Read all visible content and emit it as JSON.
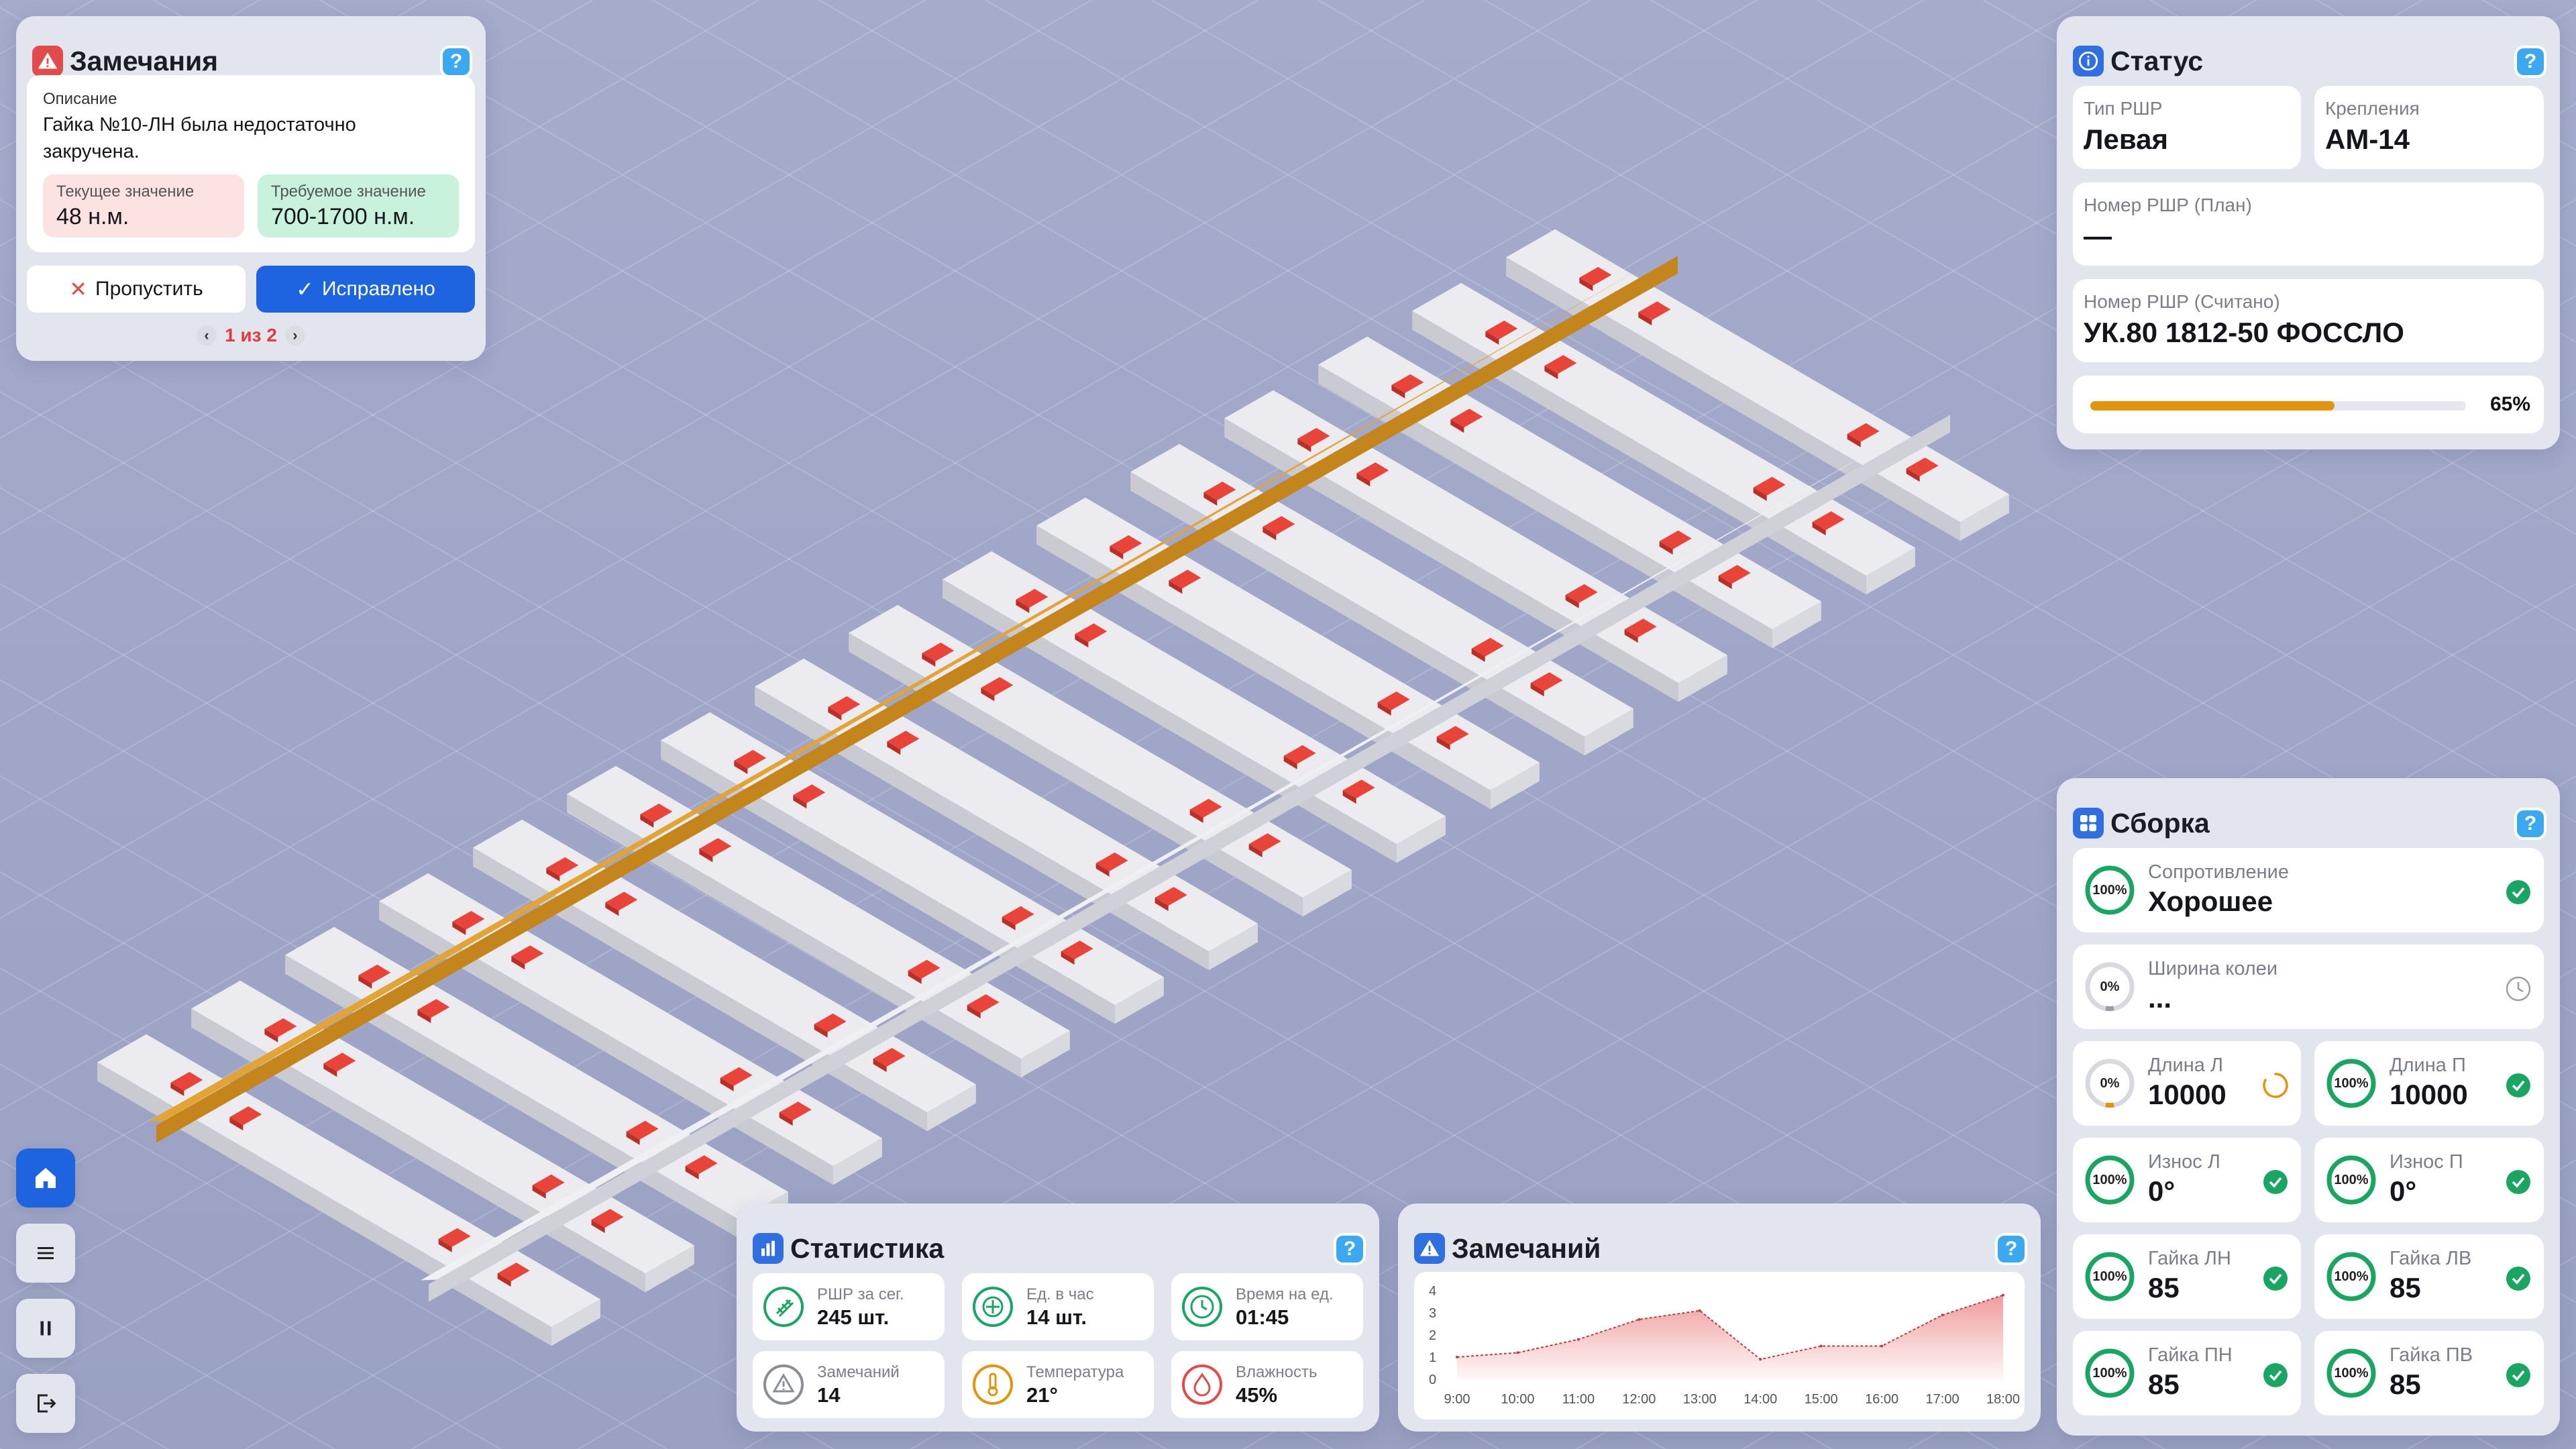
{
  "remarks": {
    "title": "Замечания",
    "desc_label": "Описание",
    "desc_text": "Гайка №10-ЛН была недостаточно закручена.",
    "current_label": "Текущее значение",
    "current_value": "48 н.м.",
    "required_label": "Требуемое значение",
    "required_value": "700-1700 н.м.",
    "skip_label": "Пропустить",
    "fixed_label": "Исправлено",
    "pager": "1 из 2",
    "colors": {
      "icon": "#e24b4b",
      "primary": "#1e63e0",
      "current_bg": "#fde2e2",
      "required_bg": "#c9f2dd"
    }
  },
  "status": {
    "title": "Статус",
    "type_label": "Тип РШР",
    "type_value": "Левая",
    "fasten_label": "Крепления",
    "fasten_value": "АМ-14",
    "plan_label": "Номер РШР (План)",
    "plan_value": "—",
    "read_label": "Номер РШР (Считано)",
    "read_value": "УК.80 1812-50 ФОССЛО",
    "progress": 0.65,
    "progress_text": "65%",
    "colors": {
      "icon": "#2f6fe0",
      "progress": "#e0940f"
    }
  },
  "assembly": {
    "title": "Сборка",
    "colors": {
      "ok": "#1aa563",
      "pending": "#e0940f",
      "idle": "#9a9ca6",
      "icon": "#2f6fe0"
    },
    "resistance": {
      "label": "Сопротивление",
      "value": "Хорошее",
      "pct": "100%",
      "state": "check-icon"
    },
    "gauge": {
      "label": "Ширина колеи",
      "value": "...",
      "pct": "0%",
      "state": "clock-icon"
    },
    "items": [
      {
        "label": "Длина Л",
        "value": "10000",
        "pct": "0%",
        "state": "loading-icon"
      },
      {
        "label": "Длина П",
        "value": "10000",
        "pct": "100%",
        "state": "check-icon"
      },
      {
        "label": "Износ Л",
        "value": "0°",
        "pct": "100%",
        "state": "check-icon"
      },
      {
        "label": "Износ П",
        "value": "0°",
        "pct": "100%",
        "state": "check-icon"
      },
      {
        "label": "Гайка ЛН",
        "value": "85",
        "pct": "100%",
        "state": "check-icon"
      },
      {
        "label": "Гайка ЛВ",
        "value": "85",
        "pct": "100%",
        "state": "check-icon"
      },
      {
        "label": "Гайка ПН",
        "value": "85",
        "pct": "100%",
        "state": "check-icon"
      },
      {
        "label": "Гайка ПВ",
        "value": "85",
        "pct": "100%",
        "state": "check-icon"
      }
    ]
  },
  "stats": {
    "title": "Статистика",
    "items": [
      {
        "label": "РШР за сег.",
        "value": "245 шт.",
        "icon": "rail-icon",
        "color": "#1aa563"
      },
      {
        "label": "Ед. в час",
        "value": "14 шт.",
        "icon": "crosshair-icon",
        "color": "#1aa563"
      },
      {
        "label": "Время на ед.",
        "value": "01:45",
        "icon": "clock-icon",
        "color": "#1aa563"
      },
      {
        "label": "Замечаний",
        "value": "14",
        "icon": "warning-icon",
        "color": "#8a8c96"
      },
      {
        "label": "Температура",
        "value": "21°",
        "icon": "thermometer-icon",
        "color": "#e0940f"
      },
      {
        "label": "Влажность",
        "value": "45%",
        "icon": "drop-icon",
        "color": "#e24b4b"
      }
    ]
  },
  "remarks_chart": {
    "title": "Замечаний"
  },
  "chart_data": {
    "type": "area",
    "x": [
      "9:00",
      "10:00",
      "11:00",
      "12:00",
      "13:00",
      "14:00",
      "15:00",
      "16:00",
      "17:00",
      "18:00"
    ],
    "series": [
      {
        "values": [
          1,
          1.2,
          1.8,
          2.7,
          3.1,
          0.9,
          1.5,
          1.5,
          2.9,
          3.8
        ]
      }
    ],
    "yticks": [
      "0",
      "1",
      "2",
      "3",
      "4"
    ],
    "ylim": [
      0,
      4
    ],
    "color": "#e24b4b"
  },
  "nav": [
    "home-icon",
    "menu-icon",
    "pause-icon",
    "exit-icon"
  ],
  "scene": {
    "sleepers": 16
  }
}
